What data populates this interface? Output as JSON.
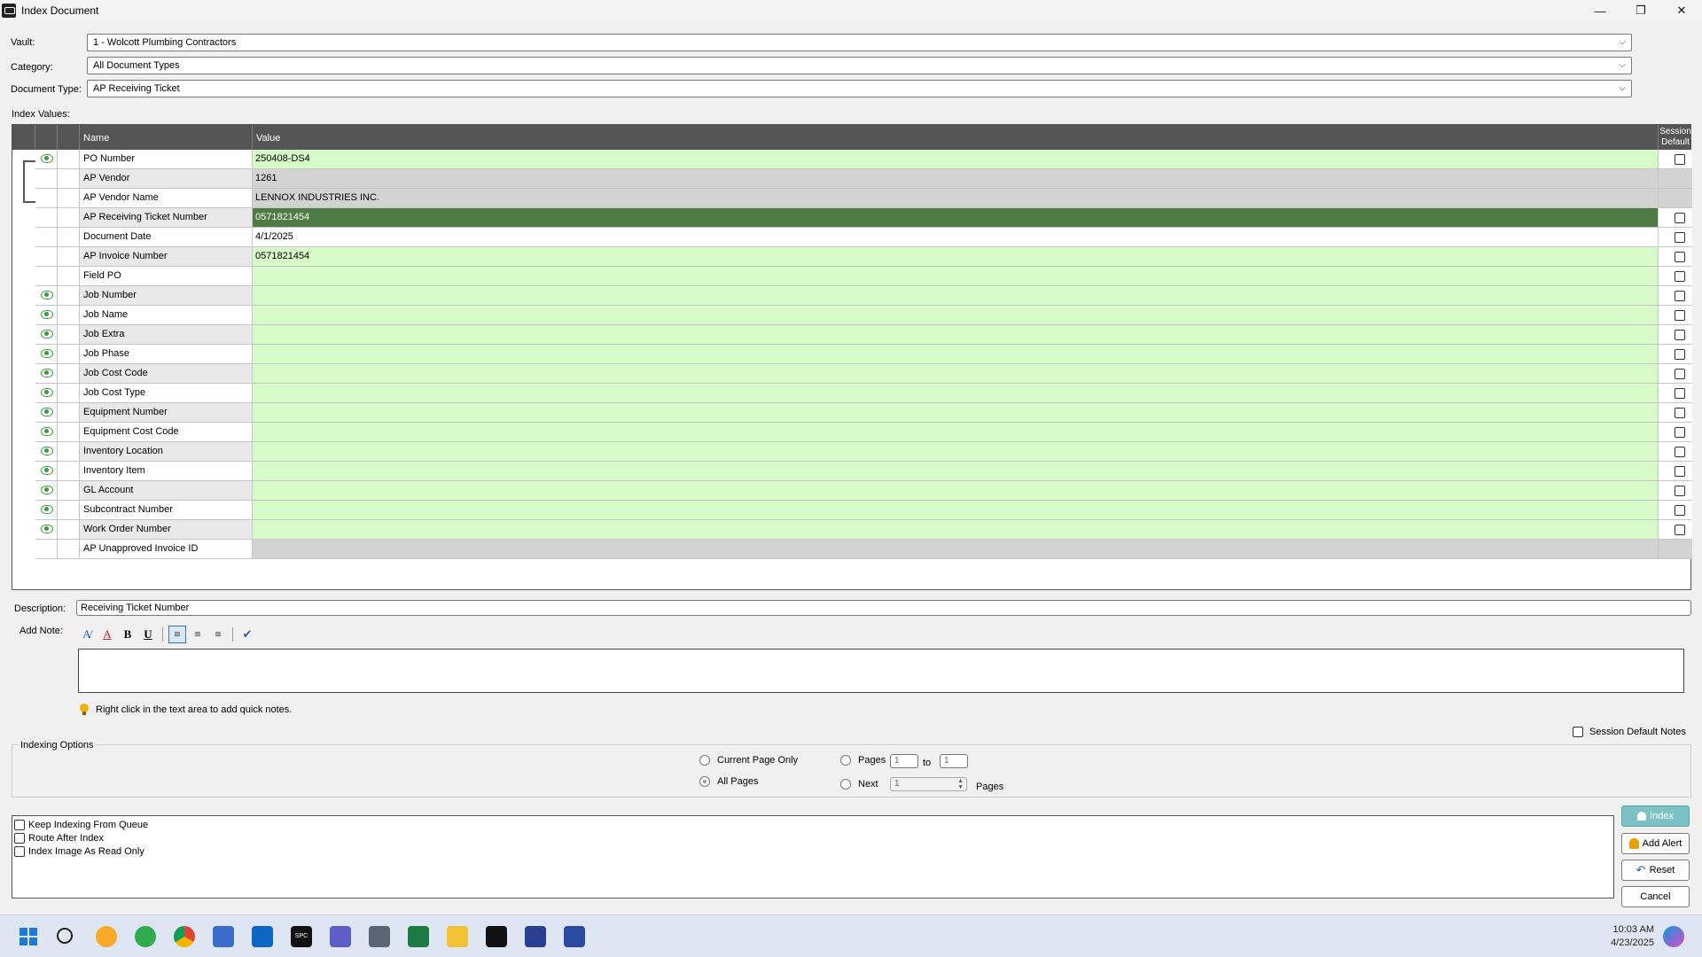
{
  "window": {
    "title": "Index Document",
    "minimize": "—",
    "maximize": "❐",
    "close": "✕"
  },
  "header": {
    "vault_label": "Vault:",
    "vault_value": "1 - Wolcott Plumbing Contractors",
    "category_label": "Category:",
    "category_value": "All Document Types",
    "doctype_label": "Document Type:",
    "doctype_value": "AP Receiving Ticket"
  },
  "index_values_label": "Index Values:",
  "grid": {
    "col_name": "Name",
    "col_value": "Value",
    "col_session_1": "Session",
    "col_session_2": "Default",
    "rows": [
      {
        "name": "PO Number",
        "value": "250408-DS4",
        "eye": true,
        "chk": true,
        "bg": "#d6fbc8",
        "namebg": "#ffffff"
      },
      {
        "name": "AP Vendor",
        "value": "1261",
        "eye": false,
        "chk": false,
        "bg": "#d3d3d3",
        "namebg": "#e9e9e9"
      },
      {
        "name": "AP Vendor Name",
        "value": "LENNOX INDUSTRIES INC.",
        "eye": false,
        "chk": false,
        "bg": "#d3d3d3",
        "namebg": "#ffffff"
      },
      {
        "name": "AP Receiving Ticket Number",
        "value": "0571821454",
        "eye": false,
        "chk": true,
        "bg": "#4e7a44",
        "namebg": "#e9e9e9",
        "selected": true
      },
      {
        "name": "Document Date",
        "value": "4/1/2025",
        "eye": false,
        "chk": true,
        "bg": "#ffffff",
        "namebg": "#ffffff"
      },
      {
        "name": "AP Invoice Number",
        "value": "0571821454",
        "eye": false,
        "chk": true,
        "bg": "#d6fbc8",
        "namebg": "#e9e9e9"
      },
      {
        "name": "Field PO",
        "value": "",
        "eye": false,
        "chk": true,
        "bg": "#d6fbc8",
        "namebg": "#ffffff"
      },
      {
        "name": "Job Number",
        "value": "",
        "eye": true,
        "chk": true,
        "bg": "#d6fbc8",
        "namebg": "#e9e9e9"
      },
      {
        "name": "Job Name",
        "value": "",
        "eye": true,
        "chk": true,
        "bg": "#d6fbc8",
        "namebg": "#ffffff"
      },
      {
        "name": "Job Extra",
        "value": "",
        "eye": true,
        "chk": true,
        "bg": "#d6fbc8",
        "namebg": "#e9e9e9"
      },
      {
        "name": "Job Phase",
        "value": "",
        "eye": true,
        "chk": true,
        "bg": "#d6fbc8",
        "namebg": "#ffffff"
      },
      {
        "name": "Job Cost Code",
        "value": "",
        "eye": true,
        "chk": true,
        "bg": "#d6fbc8",
        "namebg": "#e9e9e9"
      },
      {
        "name": "Job Cost Type",
        "value": "",
        "eye": true,
        "chk": true,
        "bg": "#d6fbc8",
        "namebg": "#ffffff"
      },
      {
        "name": "Equipment Number",
        "value": "",
        "eye": true,
        "chk": true,
        "bg": "#d6fbc8",
        "namebg": "#e9e9e9"
      },
      {
        "name": "Equipment Cost Code",
        "value": "",
        "eye": true,
        "chk": true,
        "bg": "#d6fbc8",
        "namebg": "#ffffff"
      },
      {
        "name": "Inventory Location",
        "value": "",
        "eye": true,
        "chk": true,
        "bg": "#d6fbc8",
        "namebg": "#e9e9e9"
      },
      {
        "name": "Inventory Item",
        "value": "",
        "eye": true,
        "chk": true,
        "bg": "#d6fbc8",
        "namebg": "#ffffff"
      },
      {
        "name": "GL Account",
        "value": "",
        "eye": true,
        "chk": true,
        "bg": "#d6fbc8",
        "namebg": "#e9e9e9"
      },
      {
        "name": "Subcontract Number",
        "value": "",
        "eye": true,
        "chk": true,
        "bg": "#d6fbc8",
        "namebg": "#ffffff"
      },
      {
        "name": "Work Order Number",
        "value": "",
        "eye": true,
        "chk": true,
        "bg": "#d6fbc8",
        "namebg": "#e9e9e9"
      },
      {
        "name": "AP Unapproved Invoice ID",
        "value": "",
        "eye": false,
        "chk": false,
        "bg": "#d3d3d3",
        "namebg": "#ffffff"
      }
    ]
  },
  "description": {
    "label": "Description:",
    "value": "Receiving Ticket Number"
  },
  "note": {
    "label": "Add Note:",
    "hint": "Right click in the text area to add quick notes."
  },
  "session_default_notes": "Session Default Notes",
  "indexing_options": {
    "title": "Indexing Options",
    "current_page_only": "Current Page Only",
    "all_pages": "All Pages",
    "pages": "Pages",
    "pages_from": "1",
    "to": "to",
    "pages_to": "1",
    "next": "Next",
    "next_value": "1",
    "pages_suffix": "Pages"
  },
  "queue": {
    "keep_indexing": "Keep Indexing From Queue",
    "route_after": "Route After Index",
    "read_only": "Index Image As Read Only"
  },
  "buttons": {
    "index": "Index",
    "add_alert": "Add Alert",
    "reset": "Reset",
    "cancel": "Cancel"
  },
  "taskbar": {
    "time": "10:03 AM",
    "date": "4/23/2025",
    "spc_label": "SPC"
  }
}
